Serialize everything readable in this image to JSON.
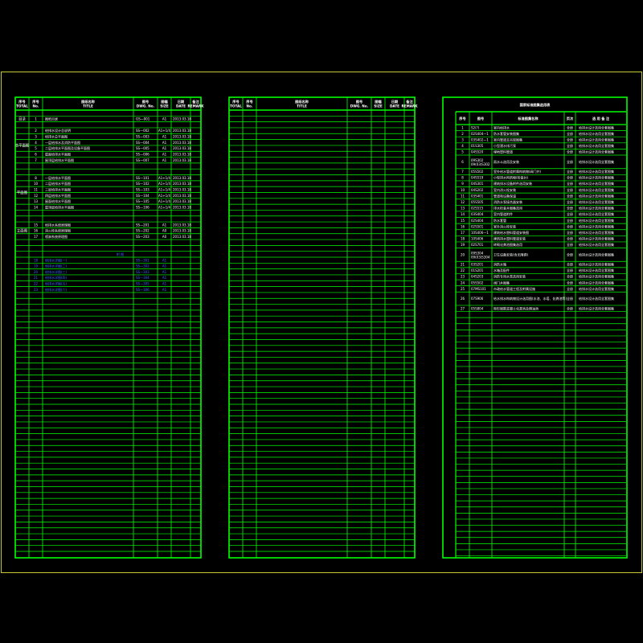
{
  "colors": {
    "line": "#00ff00",
    "text": "#ffffff",
    "highlight": "#3a6bff",
    "frame": "#c8c832"
  },
  "panel1": {
    "headers": [
      "序号",
      "序号",
      "图纸名称",
      "图号",
      "图幅",
      "日期",
      "备注"
    ],
    "header_sub": [
      "TOTAL",
      "No.",
      "TITLE",
      "DWG. No.",
      "SIZE",
      "DATE",
      "REMARK"
    ],
    "groups": [
      "目录",
      "总平面图",
      "平面图",
      "立面图"
    ],
    "rows": [
      {
        "no": "1",
        "title": "图纸目录",
        "dwg": "GS—001",
        "size": "A1",
        "date": "2013.03.18"
      },
      {
        "no": "2",
        "title": "给排水设计总说明",
        "dwg": "SS—002",
        "size": "A1+1/4",
        "date": "2013.03.18"
      },
      {
        "no": "3",
        "title": "给排水总平面图",
        "dwg": "SS—003",
        "size": "A1",
        "date": "2013.03.18"
      },
      {
        "no": "4",
        "title": "一层给排水及消防平面图",
        "dwg": "SS—004",
        "size": "A1",
        "date": "2013.03.18"
      },
      {
        "no": "5",
        "title": "二层给排水平面图及设备平面图",
        "dwg": "SS—005",
        "size": "A1",
        "date": "2013.03.18"
      },
      {
        "no": "6",
        "title": "屋面给排水平面图",
        "dwg": "SS—006",
        "size": "A1",
        "date": "2013.03.18"
      },
      {
        "no": "7",
        "title": "屋顶层给排水平面图",
        "dwg": "SS—007",
        "size": "A1",
        "date": "2013.03.18"
      },
      {
        "no": "8",
        "title": "一层给排水平面图",
        "dwg": "SS—101",
        "size": "A1+1/4",
        "date": "2013.03.18"
      },
      {
        "no": "10",
        "title": "二层给排水平面图",
        "dwg": "SS—102",
        "size": "A1+1/4",
        "date": "2013.03.18"
      },
      {
        "no": "11",
        "title": "三层给排水平面图",
        "dwg": "SS—103",
        "size": "A1+1/4",
        "date": "2013.03.18"
      },
      {
        "no": "12",
        "title": "四层给排水平面图",
        "dwg": "SS—104",
        "size": "A1+1/4",
        "date": "2013.03.18"
      },
      {
        "no": "13",
        "title": "屋面给排水平面图",
        "dwg": "SS—105",
        "size": "A1+1/4",
        "date": "2013.03.18"
      },
      {
        "no": "14",
        "title": "屋顶层给排水平面图",
        "dwg": "SS—106",
        "size": "A1+1/4",
        "date": "2013.03.18"
      },
      {
        "no": "15",
        "title": "给排水系统原理图",
        "dwg": "SS—201",
        "size": "A1",
        "date": "2013.03.18"
      },
      {
        "no": "16",
        "title": "消火栓系统原理图",
        "dwg": "SS—202",
        "size": "A0",
        "date": "2013.03.18"
      },
      {
        "no": "17",
        "title": "喷淋系统原理图",
        "dwg": "SS—203",
        "size": "A0",
        "date": "2013.03.18"
      }
    ],
    "section_label": "附 图",
    "blue_rows": [
      {
        "no": "18",
        "title": "给排水详图(一)",
        "dwg": "SS—301",
        "size": "A1"
      },
      {
        "no": "19",
        "title": "给排水详图(二)",
        "dwg": "SS—302",
        "size": "A1"
      },
      {
        "no": "20",
        "title": "给排水详图(三)",
        "dwg": "SS—303",
        "size": "A1"
      },
      {
        "no": "21",
        "title": "给排水详图(四)",
        "dwg": "SS—304",
        "size": "A1"
      },
      {
        "no": "22",
        "title": "给排水详图(五)",
        "dwg": "SS—305",
        "size": "A1"
      },
      {
        "no": "23",
        "title": "给排水详图(六)",
        "dwg": "SS—306",
        "size": "A1"
      }
    ]
  },
  "panel2": {
    "headers": [
      "序号",
      "序号",
      "图纸名称",
      "图号",
      "图幅",
      "日期",
      "备注"
    ],
    "header_sub": [
      "TOTAL",
      "No.",
      "TITLE",
      "DWG. No.",
      "SIZE",
      "DATE",
      "REMARK"
    ]
  },
  "panel3": {
    "title": "国家标准图集选用表",
    "headers": [
      "序号",
      "图号",
      "标准图集名称",
      "页次",
      "选 用 备 注"
    ],
    "rows": [
      {
        "no": "1",
        "code": "S2(?)",
        "name": "室内给排水",
        "page": "全册",
        "note": "给排水设计选用全套图集"
      },
      {
        "no": "2",
        "code": "02S404—1",
        "name": "防水套管安装图集",
        "page": "全册",
        "note": "给排水设计选用全套图集"
      },
      {
        "no": "3",
        "code": "03S402—1",
        "name": "室内管道支吊架图集",
        "page": "全册",
        "note": "给排水设计选用全套图集"
      },
      {
        "no": "4",
        "code": "01S305",
        "name": "小型潜水排污泵",
        "page": "全册",
        "note": "给排水设计选用全套图集"
      },
      {
        "no": "5",
        "code": "04S520",
        "name": "埋地塑料管道",
        "page": "全册",
        "note": "给排水设计选用全套图集"
      },
      {
        "no": "6",
        "code": "09S302 / 09(03)S302",
        "name": "雨水斗选用及安装",
        "page": "全册",
        "note": "给排水设计选用全套图集"
      },
      {
        "no": "7",
        "code": "05S502",
        "name": "室外给水管道附属构筑物(阀门井)",
        "page": "全册",
        "note": "给排水设计选用全套图集"
      },
      {
        "no": "8",
        "code": "04S519",
        "name": "小型排水构筑物(检查井)",
        "page": "全册",
        "note": "给排水设计选用全套图集"
      },
      {
        "no": "9",
        "code": "04S301",
        "name": "建筑排水设备附件选用安装",
        "page": "全册",
        "note": "给排水设计选用全套图集"
      },
      {
        "no": "10",
        "code": "04S202",
        "name": "室内消火栓安装",
        "page": "全册",
        "note": "给排水设计选用全套图集"
      },
      {
        "no": "11",
        "code": "03S401",
        "name": "管道和设备保温",
        "page": "全册",
        "note": "给排水设计选用全套图集"
      },
      {
        "no": "12",
        "code": "05S505",
        "name": "消防水泵接合器安装",
        "page": "全册",
        "note": "给排水设计选用全套图集"
      },
      {
        "no": "13",
        "code": "02S515",
        "name": "排水检查井图集选用",
        "page": "全册",
        "note": "给排水设计选用全套图集"
      },
      {
        "no": "14",
        "code": "03S404",
        "name": "室内管道附件",
        "page": "全册",
        "note": "给排水设计选用全套图集"
      },
      {
        "no": "15",
        "code": "02S404",
        "name": "防水套管",
        "page": "全册",
        "note": "给排水设计选用全套图集"
      },
      {
        "no": "16",
        "code": "02S501",
        "name": "室外消火栓安装",
        "page": "全册",
        "note": "给排水设计选用全套图集"
      },
      {
        "no": "17",
        "code": "10S406—1",
        "name": "建筑给水塑料管道安装图",
        "page": "全册",
        "note": "给排水设计选用全套图集"
      },
      {
        "no": "18",
        "code": "10S406",
        "name": "建筑排水塑料管道安装",
        "page": "全册",
        "note": "给排水设计选用全套图集"
      },
      {
        "no": "19",
        "code": "02S701",
        "name": "砖砌化粪池图集选用",
        "page": "全册",
        "note": "给排水设计选用全套图集"
      },
      {
        "no": "20",
        "code": "09S304 / 09(03)S304",
        "name": "卫生设备安装(含无障碍)",
        "page": "全册",
        "note": "给排水设计选用全套图集"
      },
      {
        "no": "21",
        "code": "03S201",
        "name": "消防水箱",
        "page": "全册",
        "note": "给排水设计选用全套图集"
      },
      {
        "no": "22",
        "code": "01S201",
        "name": "水箱及配件",
        "page": "全册",
        "note": "给排水设计选用全套图集"
      },
      {
        "no": "23",
        "code": "04S203",
        "name": "消防专用水泵选用安装",
        "page": "全册",
        "note": "给排水设计选用全套图集"
      },
      {
        "no": "24",
        "code": "05S502",
        "name": "阀门井图集",
        "page": "全册",
        "note": "给排水设计选用全套图集"
      },
      {
        "no": "25",
        "code": "07MS101",
        "name": "市政给水管道工程及附属设施",
        "page": "全册",
        "note": "给排水设计选用全套图集"
      },
      {
        "no": "26",
        "code": "07S906",
        "name": "给水排水构筑物设计选用图(水池、水塔、化粪池等)",
        "page": "全册",
        "note": "给排水设计选用全套图集"
      },
      {
        "no": "27",
        "code": "05S804",
        "name": "矩形钢筋混凝土化粪池及隔油池",
        "page": "全册",
        "note": "给排水设计选用全套图集"
      }
    ]
  }
}
